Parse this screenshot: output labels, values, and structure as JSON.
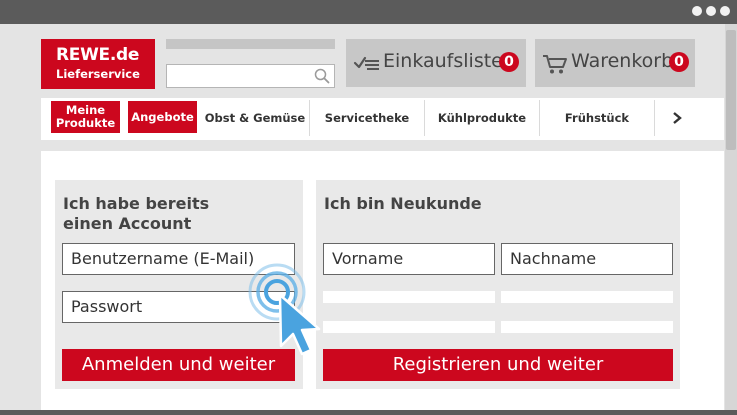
{
  "logo": {
    "line1": "REWE.de",
    "line2": "Lieferservice"
  },
  "search": {
    "value": "",
    "placeholder": ""
  },
  "header": {
    "shopping_list": {
      "label": "Einkaufsliste",
      "count": "0"
    },
    "cart": {
      "label": "Warenkorb",
      "count": "0"
    }
  },
  "nav": {
    "my_products": "Meine\nProdukte",
    "offers": "Angebote",
    "items": [
      "Obst & Gemüse",
      "Servicetheke",
      "Kühlprodukte",
      "Frühstück"
    ]
  },
  "login": {
    "title": "Ich habe bereits\neinen Account",
    "username_label": "Benutzername (E-Mail)",
    "password_label": "Passwort",
    "submit": "Anmelden und weiter"
  },
  "register": {
    "title": "Ich bin Neukunde",
    "firstname_label": "Vorname",
    "lastname_label": "Nachname",
    "submit": "Registrieren und weiter"
  },
  "colors": {
    "brand_red": "#cc071e",
    "cursor_blue": "#4aa3df",
    "titlebar": "#5b5b5b"
  }
}
